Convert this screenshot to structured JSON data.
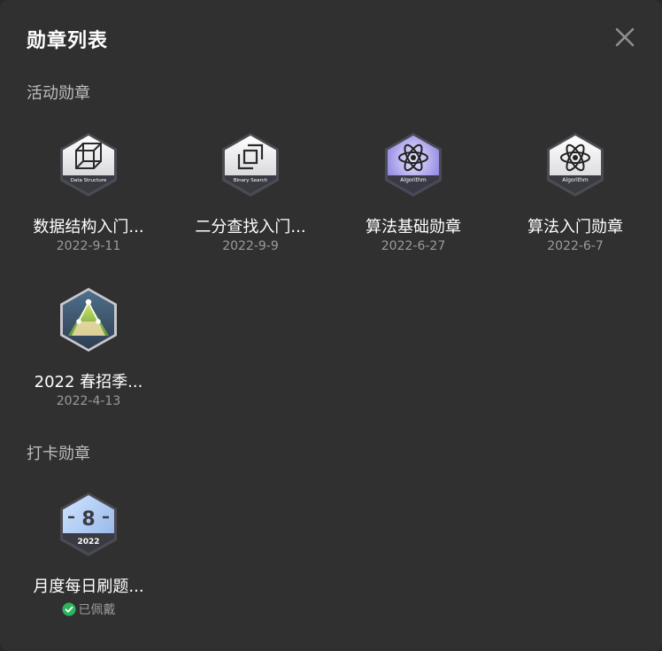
{
  "modal": {
    "title": "勋章列表",
    "close_icon": "close-icon"
  },
  "sections": [
    {
      "title": "活动勋章",
      "badges": [
        {
          "name": "数据结构入门...",
          "date": "2022-9-11",
          "icon": "data-structure-cube-icon",
          "icon_text": "Data Structure"
        },
        {
          "name": "二分查找入门...",
          "date": "2022-9-9",
          "icon": "binary-search-icon",
          "icon_text": "Binary Search"
        },
        {
          "name": "算法基础勋章",
          "date": "2022-6-27",
          "icon": "algorithm-atom-purple-icon",
          "icon_text": "Algorithm"
        },
        {
          "name": "算法入门勋章",
          "date": "2022-6-7",
          "icon": "algorithm-atom-icon",
          "icon_text": "Algorithm"
        },
        {
          "name": "2022 春招季...",
          "date": "2022-4-13",
          "icon": "spring-recruit-mountain-icon"
        }
      ]
    },
    {
      "title": "打卡勋章",
      "badges": [
        {
          "name": "月度每日刷题...",
          "status": "已佩戴",
          "icon": "monthly-8-icon",
          "icon_text": "2022",
          "icon_number": "8"
        }
      ]
    }
  ],
  "colors": {
    "background": "#303030",
    "worn_check": "#2db55d"
  }
}
